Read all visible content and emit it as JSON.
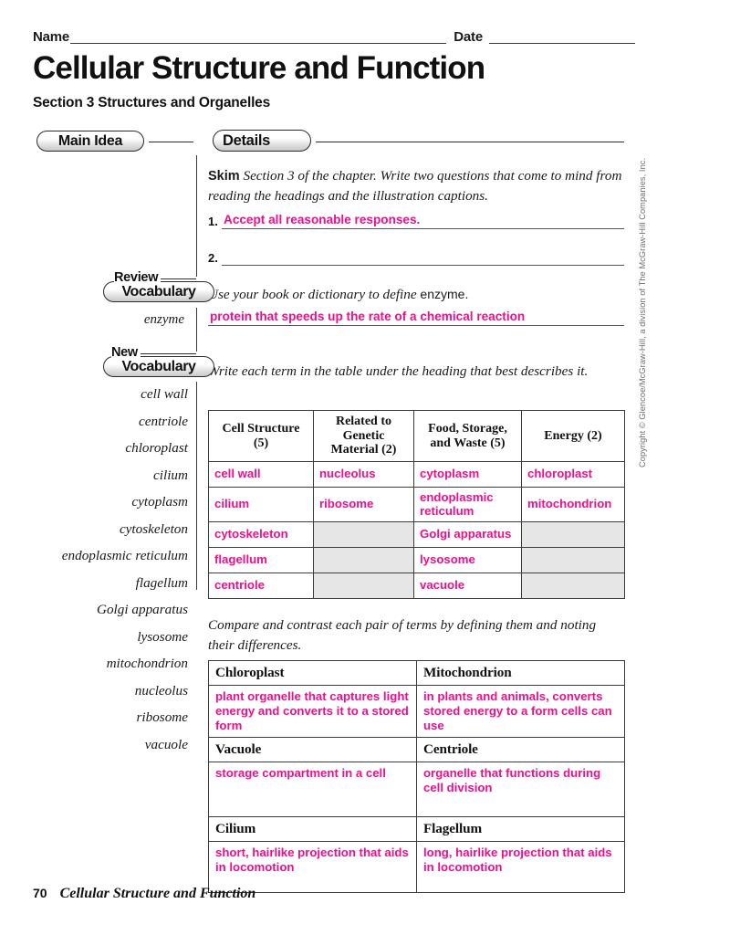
{
  "header": {
    "name_label": "Name",
    "date_label": "Date",
    "title": "Cellular Structure and Function",
    "subtitle": "Section 3  Structures and Organelles"
  },
  "columns": {
    "main_idea_label": "Main Idea",
    "details_label": "Details"
  },
  "skim": {
    "bold_word": "Skim",
    "instruction": " Section 3 of the chapter. Write two questions that come to mind from reading the headings and the illustration captions.",
    "items": [
      {
        "number": "1.",
        "answer": "Accept all reasonable responses."
      },
      {
        "number": "2.",
        "answer": ""
      }
    ]
  },
  "review_vocabulary": {
    "pill_top": "Review",
    "pill_bottom": "Vocabulary",
    "instruction_italic": "Use your book or dictionary to define ",
    "instruction_term": "enzyme.",
    "term": "enzyme",
    "answer": "protein that speeds up the rate of a chemical reaction"
  },
  "new_vocabulary": {
    "pill_top": "New",
    "pill_bottom": "Vocabulary",
    "instruction": "Write each term in the table under the heading that best describes it.",
    "terms": [
      "cell wall",
      "centriole",
      "chloroplast",
      "cilium",
      "cytoplasm",
      "cytoskeleton",
      "endoplasmic reticulum",
      "flagellum",
      "Golgi apparatus",
      "lysosome",
      "mitochondrion",
      "nucleolus",
      "ribosome",
      "vacuole"
    ]
  },
  "classification_table": {
    "headers": [
      "Cell\nStructure (5)",
      "Related to\nGenetic\nMaterial (2)",
      "Food,\nStorage, and\nWaste (5)",
      "Energy (2)"
    ],
    "headers_flat": [
      "Cell Structure (5)",
      "Related to Genetic Material (2)",
      "Food, Storage, and Waste (5)",
      "Energy (2)"
    ],
    "rows": [
      [
        "cell wall",
        "nucleolus",
        "cytoplasm",
        "chloroplast"
      ],
      [
        "cilium",
        "ribosome",
        "endoplasmic reticulum",
        "mitochondrion"
      ],
      [
        "cytoskeleton",
        "",
        "Golgi apparatus",
        ""
      ],
      [
        "flagellum",
        "",
        "lysosome",
        ""
      ],
      [
        "centriole",
        "",
        "vacuole",
        ""
      ]
    ]
  },
  "compare_contrast": {
    "instruction": "Compare and contrast each pair of terms by defining them and noting their differences.",
    "pairs": [
      {
        "left_term": "Chloroplast",
        "right_term": "Mitochondrion",
        "left_answer": "plant organelle that captures light energy and converts it to a stored form",
        "right_answer": "in plants and animals, converts stored energy to a form cells can use"
      },
      {
        "left_term": "Vacuole",
        "right_term": "Centriole",
        "left_answer": "storage compartment in a cell",
        "right_answer": "organelle that functions during cell division"
      },
      {
        "left_term": "Cilium",
        "right_term": "Flagellum",
        "left_answer": "short, hairlike projection that aids in locomotion",
        "right_answer": "long, hairlike projection that aids in locomotion"
      }
    ]
  },
  "copyright": "Copyright © Glencoe/McGraw-Hill, a division of The McGraw-Hill Companies, Inc.",
  "footer": {
    "page_number": "70",
    "text": "Cellular Structure and Function"
  },
  "colors": {
    "answer_pink": "#ED0F8C",
    "ink": "#1a1a1a",
    "empty_cell_gray": "#e6e6e6"
  }
}
